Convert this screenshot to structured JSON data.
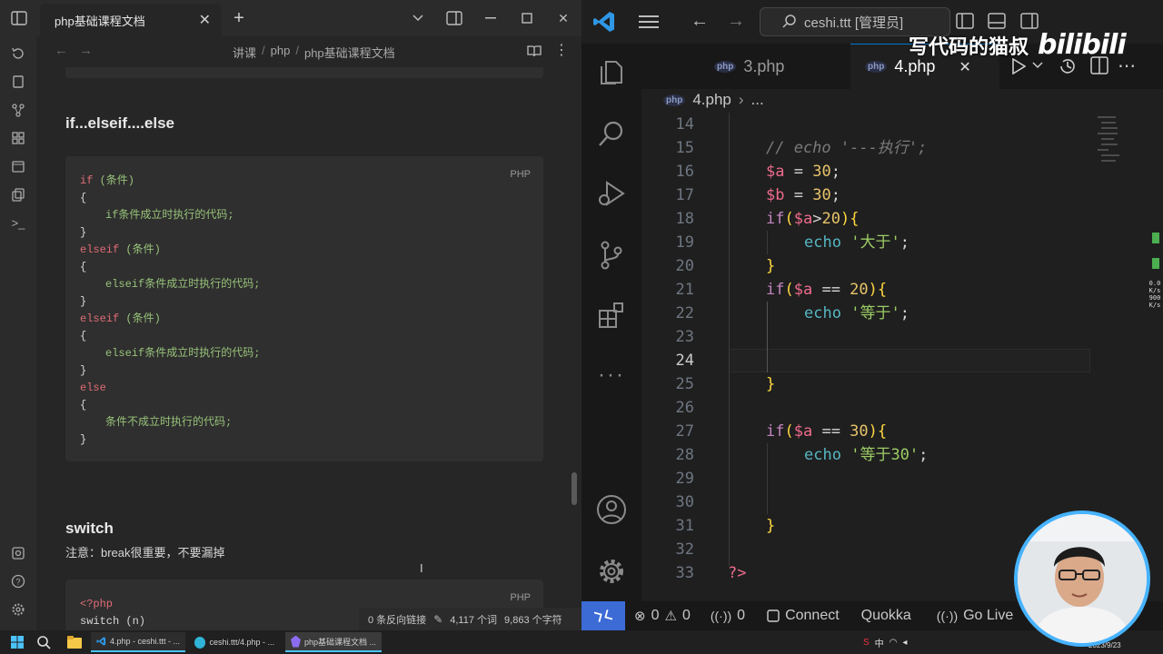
{
  "notes_app": {
    "tab_title": "php基础课程文档",
    "breadcrumb": [
      "讲课",
      "php",
      "php基础课程文档"
    ],
    "sections": {
      "ifelse_heading": "if...elseif....else",
      "switch_heading": "switch",
      "switch_note": "注意：break很重要，不要漏掉"
    },
    "code_lang": "PHP",
    "ifelse_code": [
      {
        "text": "if (条件)",
        "style": "if-line",
        "indent": false
      },
      {
        "text": "{",
        "style": "plain",
        "indent": false
      },
      {
        "text": "if条件成立时执行的代码;",
        "style": "chinese",
        "indent": true
      },
      {
        "text": "}",
        "style": "plain",
        "indent": false
      },
      {
        "text": "elseif (条件)",
        "style": "if-line",
        "indent": false
      },
      {
        "text": "{",
        "style": "plain",
        "indent": false
      },
      {
        "text": "elseif条件成立时执行的代码;",
        "style": "chinese",
        "indent": true
      },
      {
        "text": "}",
        "style": "plain",
        "indent": false
      },
      {
        "text": "elseif (条件)",
        "style": "if-line",
        "indent": false
      },
      {
        "text": "{",
        "style": "plain",
        "indent": false
      },
      {
        "text": "elseif条件成立时执行的代码;",
        "style": "chinese",
        "indent": true
      },
      {
        "text": "}",
        "style": "plain",
        "indent": false
      },
      {
        "text": "else",
        "style": "keyword",
        "indent": false
      },
      {
        "text": "{",
        "style": "plain",
        "indent": false
      },
      {
        "text": "条件不成立时执行的代码;",
        "style": "chinese",
        "indent": true
      },
      {
        "text": "}",
        "style": "plain",
        "indent": false
      }
    ],
    "switch_code": [
      "<?php",
      "switch (n)"
    ],
    "status": {
      "backlinks": "0 条反向链接",
      "words": "4,117 个词",
      "chars": "9,863 个字符"
    }
  },
  "vscode": {
    "search": "ceshi.ttt [管理员]",
    "tabs": [
      {
        "label": "3.php",
        "active": false,
        "icon": "php-file-icon"
      },
      {
        "label": "4.php",
        "active": true,
        "icon": "php-file-icon"
      }
    ],
    "breadcrumb": [
      "4.php",
      "..."
    ],
    "active_line": "24",
    "code": [
      {
        "ln": "14",
        "indent": 0,
        "tokens": []
      },
      {
        "ln": "15",
        "indent": 1,
        "tokens": [
          {
            "t": "// echo '---执行';",
            "c": "cmt"
          }
        ]
      },
      {
        "ln": "16",
        "indent": 1,
        "tokens": [
          {
            "t": "$a",
            "c": "var"
          },
          {
            "t": " = ",
            "c": "op"
          },
          {
            "t": "30",
            "c": "num"
          },
          {
            "t": ";",
            "c": "op"
          }
        ]
      },
      {
        "ln": "17",
        "indent": 1,
        "tokens": [
          {
            "t": "$b",
            "c": "var"
          },
          {
            "t": " = ",
            "c": "op"
          },
          {
            "t": "30",
            "c": "num"
          },
          {
            "t": ";",
            "c": "op"
          }
        ]
      },
      {
        "ln": "18",
        "indent": 1,
        "tokens": [
          {
            "t": "if",
            "c": "kw"
          },
          {
            "t": "(",
            "c": "br"
          },
          {
            "t": "$a",
            "c": "var"
          },
          {
            "t": ">",
            "c": "op"
          },
          {
            "t": "20",
            "c": "num"
          },
          {
            "t": "){",
            "c": "br"
          }
        ]
      },
      {
        "ln": "19",
        "indent": 2,
        "tokens": [
          {
            "t": "echo",
            "c": "fn"
          },
          {
            "t": " ",
            "c": "op"
          },
          {
            "t": "'大于'",
            "c": "str"
          },
          {
            "t": ";",
            "c": "op"
          }
        ]
      },
      {
        "ln": "20",
        "indent": 1,
        "tokens": [
          {
            "t": "}",
            "c": "br"
          }
        ]
      },
      {
        "ln": "21",
        "indent": 1,
        "tokens": [
          {
            "t": "if",
            "c": "kw"
          },
          {
            "t": "(",
            "c": "br"
          },
          {
            "t": "$a",
            "c": "var"
          },
          {
            "t": " == ",
            "c": "op"
          },
          {
            "t": "20",
            "c": "num"
          },
          {
            "t": "){",
            "c": "br"
          }
        ]
      },
      {
        "ln": "22",
        "indent": 2,
        "tokens": [
          {
            "t": "echo",
            "c": "fn"
          },
          {
            "t": " ",
            "c": "op"
          },
          {
            "t": "'等于'",
            "c": "str"
          },
          {
            "t": ";",
            "c": "op"
          }
        ]
      },
      {
        "ln": "23",
        "indent": 0,
        "tokens": []
      },
      {
        "ln": "24",
        "indent": 0,
        "tokens": []
      },
      {
        "ln": "25",
        "indent": 1,
        "tokens": [
          {
            "t": "}",
            "c": "br"
          }
        ]
      },
      {
        "ln": "26",
        "indent": 0,
        "tokens": []
      },
      {
        "ln": "27",
        "indent": 1,
        "tokens": [
          {
            "t": "if",
            "c": "kw"
          },
          {
            "t": "(",
            "c": "br"
          },
          {
            "t": "$a",
            "c": "var"
          },
          {
            "t": " == ",
            "c": "op"
          },
          {
            "t": "30",
            "c": "num"
          },
          {
            "t": "){",
            "c": "br"
          }
        ]
      },
      {
        "ln": "28",
        "indent": 2,
        "tokens": [
          {
            "t": "echo",
            "c": "fn"
          },
          {
            "t": " ",
            "c": "op"
          },
          {
            "t": "'等于30'",
            "c": "str"
          },
          {
            "t": ";",
            "c": "op"
          }
        ]
      },
      {
        "ln": "29",
        "indent": 0,
        "tokens": []
      },
      {
        "ln": "30",
        "indent": 0,
        "tokens": []
      },
      {
        "ln": "31",
        "indent": 1,
        "tokens": [
          {
            "t": "}",
            "c": "br"
          }
        ]
      },
      {
        "ln": "32",
        "indent": 0,
        "tokens": []
      },
      {
        "ln": "33",
        "indent": 0,
        "tokens": [
          {
            "t": "?>",
            "c": "var"
          }
        ]
      }
    ],
    "status": {
      "errors": "0",
      "warnings": "0",
      "ports": "0",
      "connect": "Connect",
      "quokka": "Quokka",
      "golive": "Go Live"
    },
    "minimap_stats": [
      "0.0",
      "K/s",
      "900",
      "K/s"
    ]
  },
  "taskbar": {
    "apps": [
      "4.php - ceshi.ttt - ...",
      "ceshi.ttt/4.php - ...",
      "php基础课程文档 ..."
    ],
    "tray": "中",
    "date": "2023/9/23"
  },
  "watermark": {
    "text": "写代码的猫叔",
    "logo": "bilibili"
  },
  "colors": {
    "notes_bg": "#262626",
    "code_red": "#e06c75",
    "code_green": "#98c379",
    "vs_accent": "#0078d4",
    "vs_remote": "#3c6bd6",
    "cam_border": "#46b3ff"
  }
}
